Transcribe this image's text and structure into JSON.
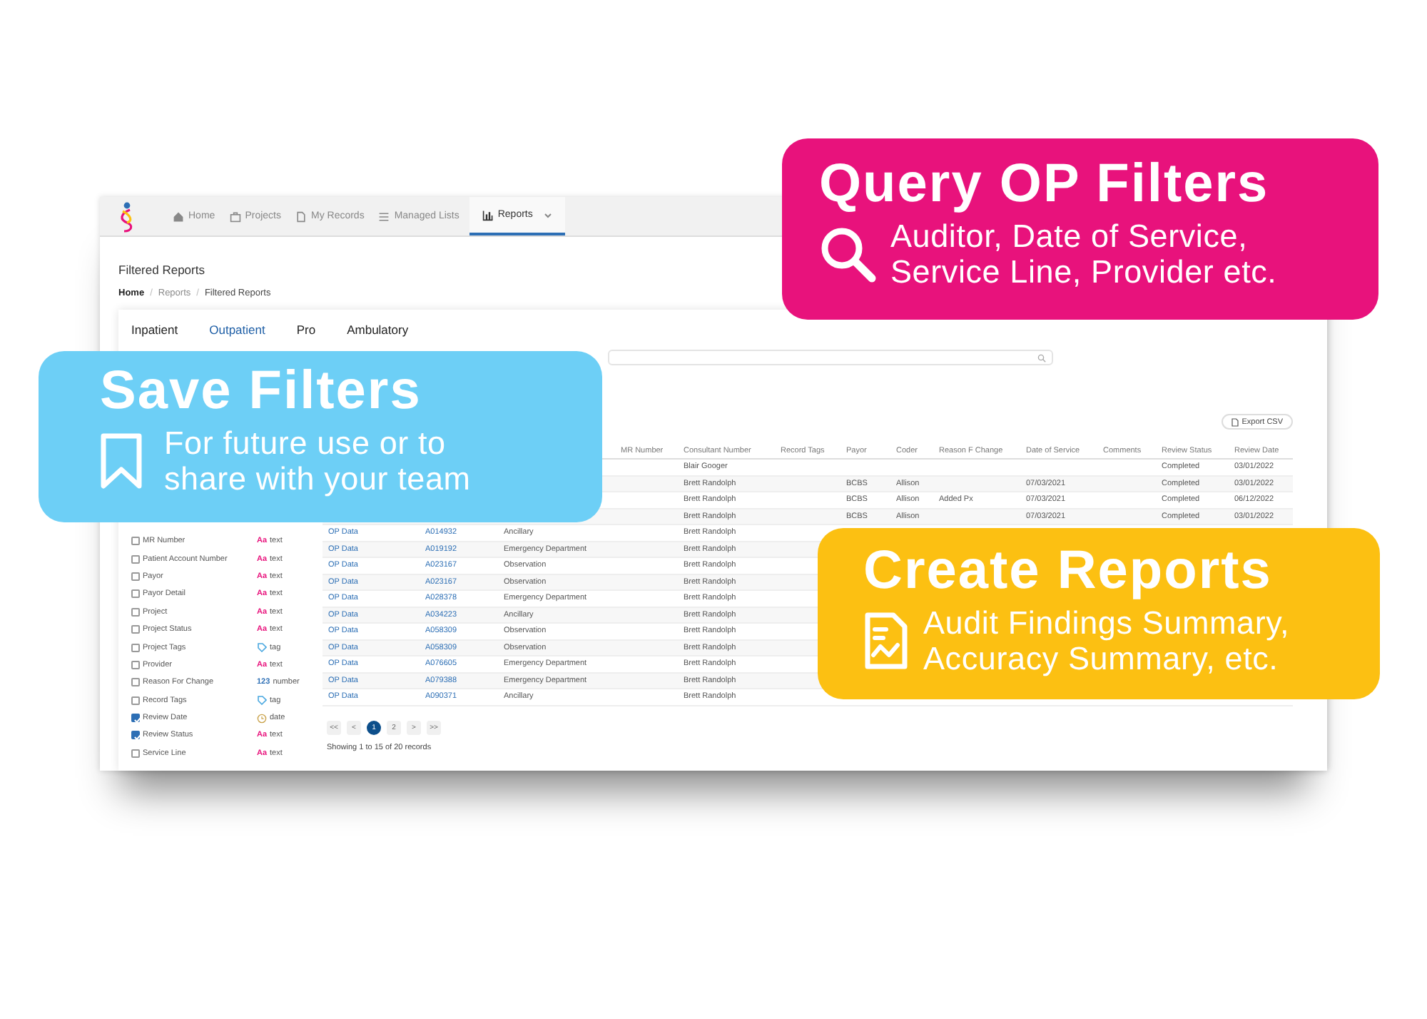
{
  "nav": {
    "items": [
      {
        "label": "Home",
        "selected": false
      },
      {
        "label": "Projects",
        "selected": false
      },
      {
        "label": "My Records",
        "selected": false
      },
      {
        "label": "Managed Lists",
        "selected": false
      },
      {
        "label": "Reports",
        "selected": true,
        "dropdown": true
      }
    ]
  },
  "page": {
    "title": "Filtered Reports",
    "breadcrumb": [
      {
        "label": "Home",
        "current": false
      },
      {
        "separator": "/",
        "label": "Reports",
        "current": false
      },
      {
        "separator": "/",
        "label": "Filtered Reports",
        "current": true
      }
    ]
  },
  "tabs": [
    {
      "label": "Inpatient",
      "selected": false
    },
    {
      "label": "Outpatient",
      "selected": true
    },
    {
      "label": "Pro",
      "selected": false
    },
    {
      "label": "Ambulatory",
      "selected": false
    }
  ],
  "export_button": "Export CSV",
  "filters": [
    {
      "label": "MR Number",
      "kind": "text",
      "glyph": "Aa",
      "type": "text",
      "checked": false
    },
    {
      "label": "Patient Account Number",
      "kind": "text",
      "glyph": "Aa",
      "type": "text",
      "checked": false
    },
    {
      "label": "Payor",
      "kind": "text",
      "glyph": "Aa",
      "type": "text",
      "checked": false
    },
    {
      "label": "Payor Detail",
      "kind": "text",
      "glyph": "Aa",
      "type": "text",
      "checked": false
    },
    {
      "label": "Project",
      "kind": "text",
      "glyph": "Aa",
      "type": "text",
      "checked": false
    },
    {
      "label": "Project Status",
      "kind": "text",
      "glyph": "Aa",
      "type": "text",
      "checked": false
    },
    {
      "label": "Project Tags",
      "kind": "tag",
      "type": "tag",
      "checked": false
    },
    {
      "label": "Provider",
      "kind": "text",
      "glyph": "Aa",
      "type": "text",
      "checked": false
    },
    {
      "label": "Reason For Change",
      "kind": "number",
      "glyph": "123",
      "type": "number",
      "checked": false
    },
    {
      "label": "Record Tags",
      "kind": "tag",
      "type": "tag",
      "checked": false
    },
    {
      "label": "Review Date",
      "kind": "date",
      "type": "date",
      "checked": true
    },
    {
      "label": "Review Status",
      "kind": "text",
      "glyph": "Aa",
      "type": "text",
      "checked": true
    },
    {
      "label": "Service Line",
      "kind": "text",
      "glyph": "Aa",
      "type": "text",
      "checked": false
    }
  ],
  "table": {
    "columns": [
      "MR Number",
      "Consultant Number",
      "Record Tags",
      "Payor",
      "Coder",
      "Reason F Change",
      "Date of Service",
      "Comments",
      "Review Status",
      "Review Date"
    ],
    "rows": [
      {
        "consultant_number": "Blair Googer",
        "review_status": "Completed",
        "review_date": "03/01/2022"
      },
      {
        "consultant_number": "Brett Randolph",
        "payor": "BCBS",
        "coder": "Allison",
        "date_of_service": "07/03/2021",
        "review_status": "Completed",
        "review_date": "03/01/2022"
      },
      {
        "consultant_number": "Brett Randolph",
        "payor": "BCBS",
        "coder": "Allison",
        "reason_f_change": "Added Px",
        "date_of_service": "07/03/2021",
        "review_status": "Completed",
        "review_date": "06/12/2022"
      },
      {
        "consultant_number": "Brett Randolph",
        "payor": "BCBS",
        "coder": "Allison",
        "date_of_service": "07/03/2021",
        "review_status": "Completed",
        "review_date": "03/01/2022"
      },
      {
        "column_1": "OP Data",
        "column_2": "A014932",
        "column_3": "Ancillary",
        "consultant_number": "Brett Randolph"
      },
      {
        "column_1": "OP Data",
        "column_2": "A019192",
        "column_3": "Emergency Department",
        "consultant_number": "Brett Randolph"
      },
      {
        "column_1": "OP Data",
        "column_2": "A023167",
        "column_3": "Observation",
        "consultant_number": "Brett Randolph"
      },
      {
        "column_1": "OP Data",
        "column_2": "A023167",
        "column_3": "Observation",
        "consultant_number": "Brett Randolph"
      },
      {
        "column_1": "OP Data",
        "column_2": "A028378",
        "column_3": "Emergency Department",
        "consultant_number": "Brett Randolph"
      },
      {
        "column_1": "OP Data",
        "column_2": "A034223",
        "column_3": "Ancillary",
        "consultant_number": "Brett Randolph"
      },
      {
        "column_1": "OP Data",
        "column_2": "A058309",
        "column_3": "Observation",
        "consultant_number": "Brett Randolph"
      },
      {
        "column_1": "OP Data",
        "column_2": "A058309",
        "column_3": "Observation",
        "consultant_number": "Brett Randolph"
      },
      {
        "column_1": "OP Data",
        "column_2": "A076605",
        "column_3": "Emergency Department",
        "consultant_number": "Brett Randolph"
      },
      {
        "column_1": "OP Data",
        "column_2": "A079388",
        "column_3": "Emergency Department",
        "consultant_number": "Brett Randolph"
      },
      {
        "column_1": "OP Data",
        "column_2": "A090371",
        "column_3": "Ancillary",
        "consultant_number": "Brett Randolph"
      }
    ]
  },
  "pagination": {
    "buttons": [
      {
        "label": "<<",
        "selected": false
      },
      {
        "label": "<",
        "selected": false
      },
      {
        "label": "1",
        "selected": true
      },
      {
        "label": "2",
        "selected": false
      },
      {
        "label": ">",
        "selected": false
      },
      {
        "label": ">>",
        "selected": false
      }
    ],
    "summary": "Showing 1 to 15 of 20 records"
  },
  "callouts": [
    {
      "kind": "query",
      "title": "Query OP Filters",
      "text": "Auditor, Date of Service,\nService Line, Provider etc."
    },
    {
      "kind": "save",
      "title": "Save Filters",
      "text": "For future use or to\nshare with your team"
    },
    {
      "kind": "report",
      "title": "Create Reports",
      "text": "Audit Findings Summary,\nAccuracy Summary, etc."
    }
  ]
}
